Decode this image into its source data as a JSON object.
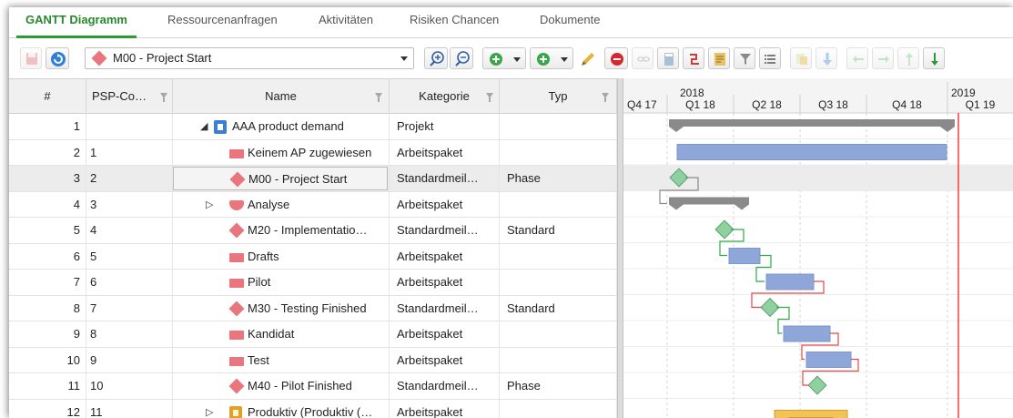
{
  "tabs": [
    {
      "label": "GANTT Diagramm",
      "active": true
    },
    {
      "label": "Ressourcenanfragen",
      "active": false
    },
    {
      "label": "Aktivitäten",
      "active": false
    },
    {
      "label": "Risiken Chancen",
      "active": false
    },
    {
      "label": "Dokumente",
      "active": false
    }
  ],
  "toolbar": {
    "selected_milestone": "M00 - Project Start",
    "buttons": [
      "save-icon",
      "refresh-icon",
      "zoom-in-icon",
      "zoom-out-icon",
      "add-green-icon",
      "add-child-icon",
      "edit-pencil-icon",
      "delete-icon",
      "link-icon",
      "calculator-icon",
      "dependency-icon",
      "report-icon",
      "filter-icon",
      "list-icon",
      "copy-icon",
      "move-down-icon",
      "outdent-icon",
      "indent-icon",
      "move-up-icon",
      "move-down-green-icon"
    ]
  },
  "grid": {
    "headers": {
      "num": "#",
      "psp": "PSP-Co…",
      "name": "Name",
      "kategorie": "Kategorie",
      "typ": "Typ"
    },
    "rows": [
      {
        "num": "1",
        "psp": "",
        "name": "AAA product demand",
        "kategorie": "Projekt",
        "typ": "",
        "icon": "project-icon",
        "expander": "◢"
      },
      {
        "num": "2",
        "psp": "1",
        "name": "Keinem AP zugewiesen",
        "kategorie": "Arbeitspaket",
        "typ": "",
        "icon": "workpackage-icon",
        "expander": ""
      },
      {
        "num": "3",
        "psp": "2",
        "name": "M00 - Project Start",
        "kategorie": "Standardmeil…",
        "typ": "Phase",
        "icon": "milestone-icon",
        "expander": ""
      },
      {
        "num": "4",
        "psp": "3",
        "name": "Analyse",
        "kategorie": "Arbeitspaket",
        "typ": "",
        "icon": "summary-icon",
        "expander": "▷"
      },
      {
        "num": "5",
        "psp": "4",
        "name": "M20 - Implementatio…",
        "kategorie": "Standardmeil…",
        "typ": "Standard",
        "icon": "milestone-icon",
        "expander": ""
      },
      {
        "num": "6",
        "psp": "5",
        "name": "Drafts",
        "kategorie": "Arbeitspaket",
        "typ": "",
        "icon": "workpackage-icon",
        "expander": ""
      },
      {
        "num": "7",
        "psp": "6",
        "name": "Pilot",
        "kategorie": "Arbeitspaket",
        "typ": "",
        "icon": "workpackage-icon",
        "expander": ""
      },
      {
        "num": "8",
        "psp": "7",
        "name": "M30 - Testing Finished",
        "kategorie": "Standardmeil…",
        "typ": "Standard",
        "icon": "milestone-icon",
        "expander": ""
      },
      {
        "num": "9",
        "psp": "8",
        "name": "Kandidat",
        "kategorie": "Arbeitspaket",
        "typ": "",
        "icon": "workpackage-icon",
        "expander": ""
      },
      {
        "num": "10",
        "psp": "9",
        "name": "Test",
        "kategorie": "Arbeitspaket",
        "typ": "",
        "icon": "workpackage-icon",
        "expander": ""
      },
      {
        "num": "11",
        "psp": "10",
        "name": "M40 - Pilot Finished",
        "kategorie": "Standardmeil…",
        "typ": "Phase",
        "icon": "milestone-icon",
        "expander": ""
      },
      {
        "num": "12",
        "psp": "11",
        "name": "Produktiv (Produktiv (…",
        "kategorie": "Arbeitspaket",
        "typ": "",
        "icon": "product-icon",
        "expander": "▷"
      }
    ]
  },
  "gantt": {
    "years": [
      "2018",
      "2019"
    ],
    "quarters": [
      "Q4 17",
      "Q1 18",
      "Q2 18",
      "Q3 18",
      "Q4 18",
      "Q1 19"
    ],
    "colors": {
      "summary": "#8a8a8a",
      "task": "#8fa6d8",
      "milestone": "#8fd0a0",
      "today": "#ff3b3b",
      "link_green": "#2ea84a",
      "link_red": "#e24848",
      "product": "#f3c357"
    }
  }
}
